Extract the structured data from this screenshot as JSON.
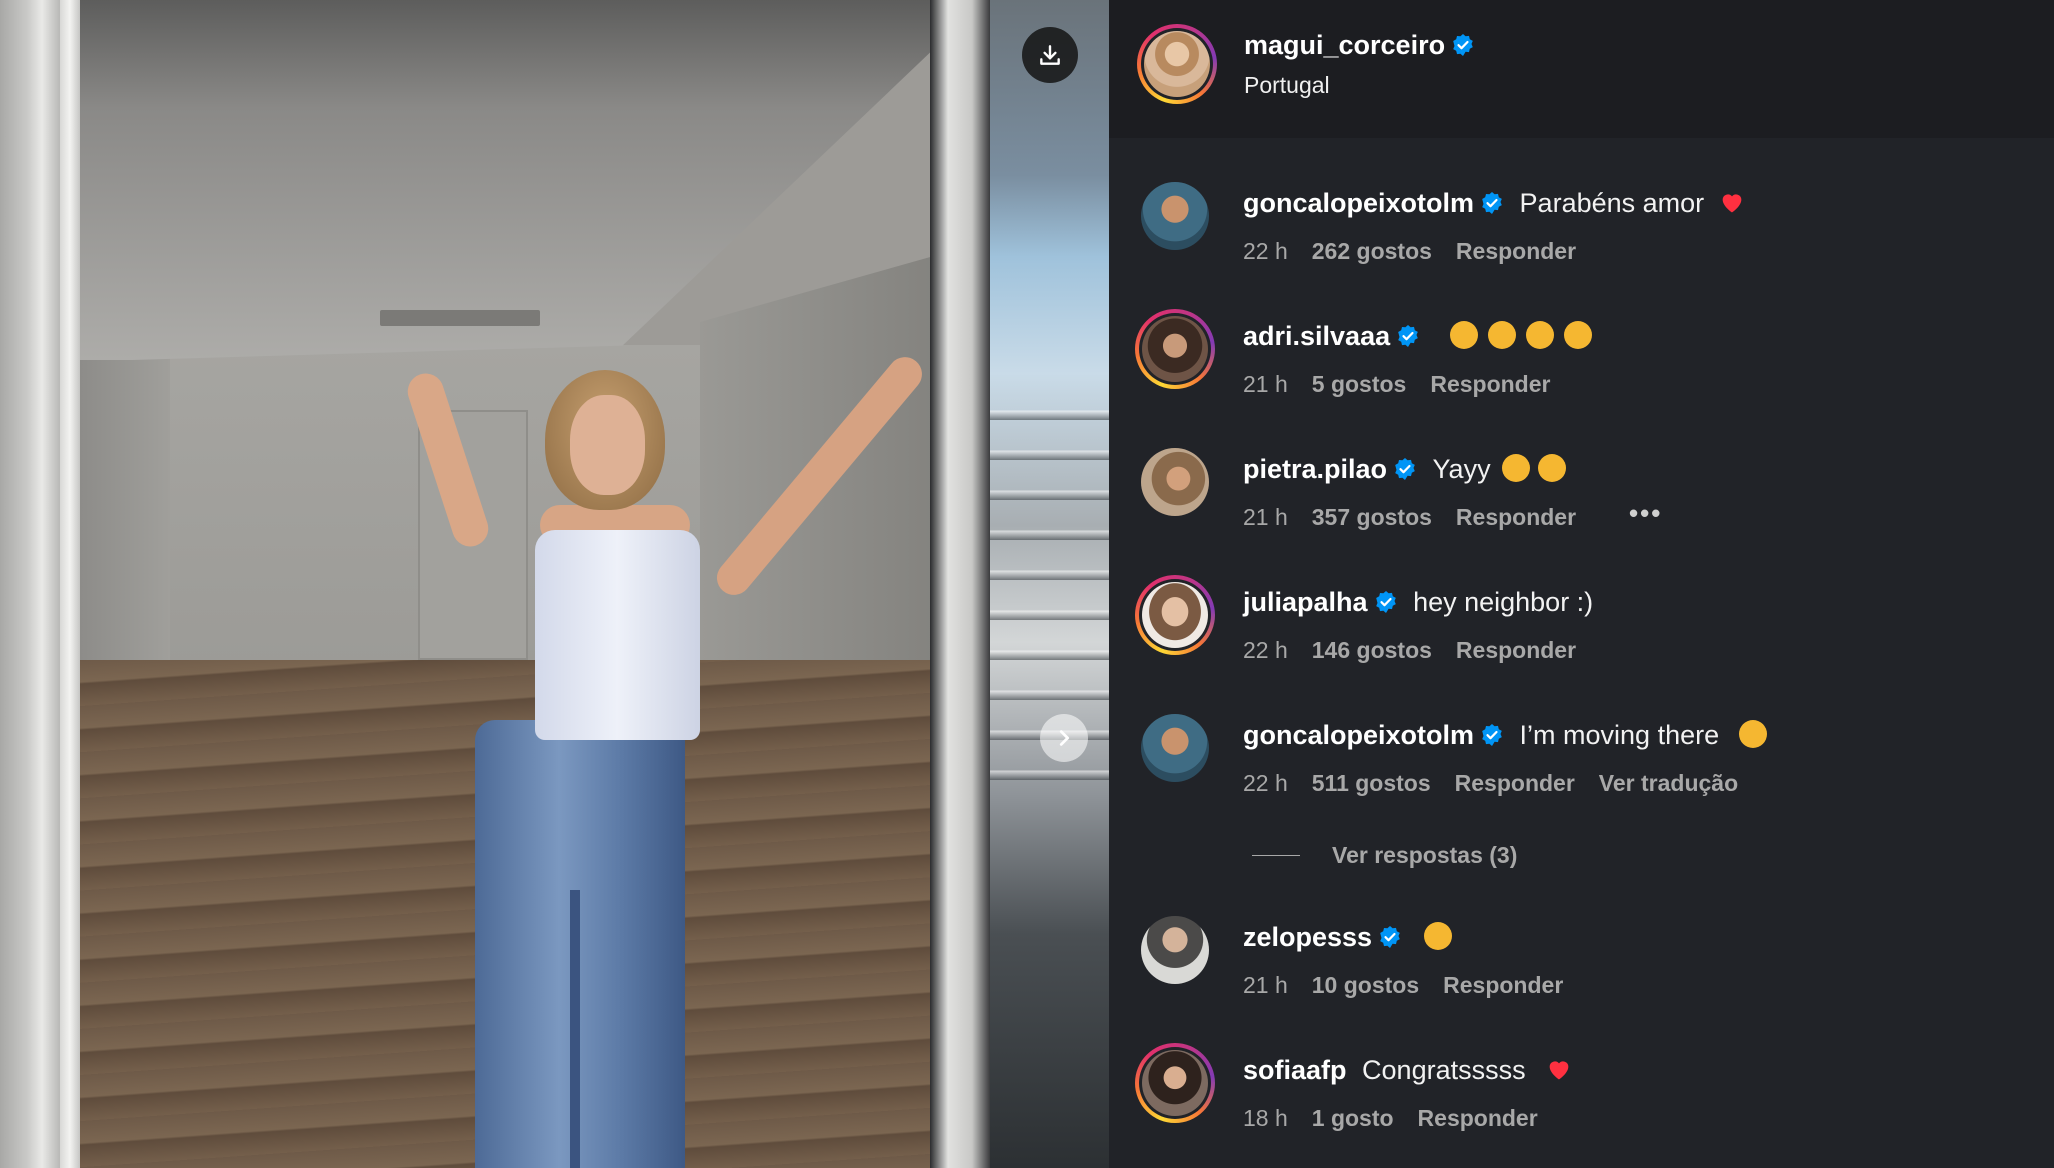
{
  "post": {
    "author": "magui_corceiro",
    "location": "Portugal",
    "verified": true
  },
  "comments": [
    {
      "user": "goncalopeixotolm",
      "verified": true,
      "text": "Parabéns amor",
      "emojis": [
        "red-heart"
      ],
      "time": "22 h",
      "likes": "262 gostos",
      "reply": "Responder"
    },
    {
      "user": "adri.silvaaa",
      "verified": true,
      "text": "",
      "emojis": [
        "kissing-face",
        "kissing-face",
        "kissing-face",
        "kissing-face"
      ],
      "time": "21 h",
      "likes": "5 gostos",
      "reply": "Responder"
    },
    {
      "user": "pietra.pilao",
      "verified": true,
      "text": "Yayy",
      "emojis": [
        "heart-eyes",
        "heart-eyes"
      ],
      "time": "21 h",
      "likes": "357 gostos",
      "reply": "Responder",
      "more": "•••"
    },
    {
      "user": "juliapalha",
      "verified": true,
      "text": "hey neighbor :)",
      "emojis": [],
      "time": "22 h",
      "likes": "146 gostos",
      "reply": "Responder"
    },
    {
      "user": "goncalopeixotolm",
      "verified": true,
      "text": "I’m moving there",
      "emojis": [
        "grinning-face"
      ],
      "time": "22 h",
      "likes": "511 gostos",
      "reply": "Responder",
      "translate": "Ver tradução"
    },
    {
      "user": "zelopesss",
      "verified": true,
      "text": "",
      "emojis": [
        "heart-eyes"
      ],
      "time": "21 h",
      "likes": "10 gostos",
      "reply": "Responder"
    },
    {
      "user": "sofiaafp",
      "verified": false,
      "text": "Congratsssss",
      "emojis": [
        "red-heart"
      ],
      "time": "18 h",
      "likes": "1 gosto",
      "reply": "Responder"
    }
  ],
  "view_replies": "Ver respostas (3)",
  "icons": {
    "download": "download-icon",
    "next": "chevron-right-icon",
    "verified": "verified-badge-icon"
  },
  "colors": {
    "panel_bg": "#212328",
    "verified_blue": "#0095f6",
    "meta_gray": "#a8a8a8"
  }
}
